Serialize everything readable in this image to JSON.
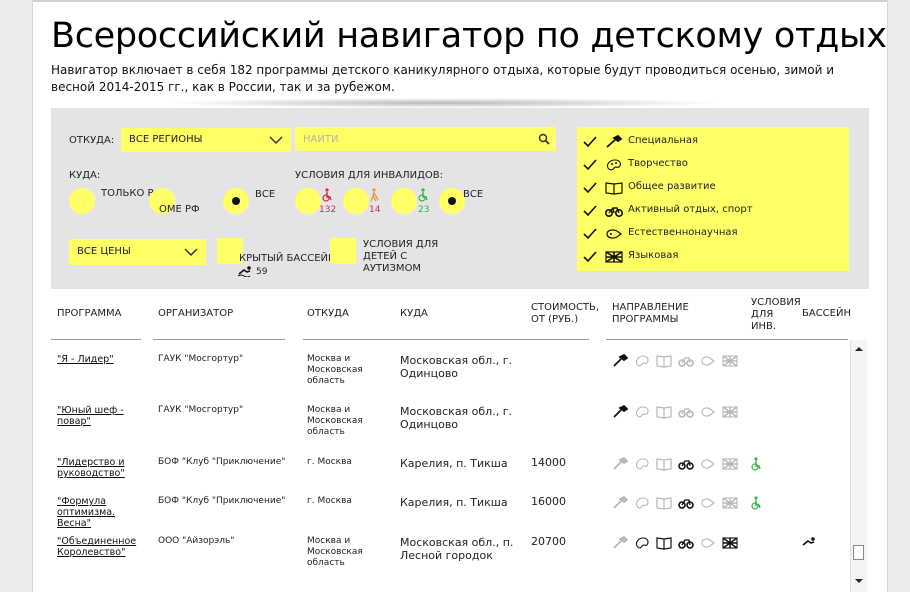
{
  "header": {
    "title": "Всероссийский навигатор по детскому отдыху",
    "intro": "Навигатор включает в себя 182 программы детского каникулярного отдыха, которые будут проводиться осенью, зимой и весной 2014-2015 гг., как в России, так и за рубежом."
  },
  "filters": {
    "from_label": "ОТКУДА:",
    "from_value": "ВСЕ РЕГИОНЫ",
    "search_placeholder": "НАЙТИ",
    "to_label": "КУДА:",
    "to_options": [
      "ТОЛЬКО РФ",
      "ОМЕ РФ",
      "ВСЕ"
    ],
    "to_selected": 2,
    "disabled_label": "УСЛОВИЯ ДЛЯ ИНВАЛИДОВ:",
    "disabled_counts": [
      "132",
      "14",
      "23"
    ],
    "disabled_all": "ВСЕ",
    "price_value": "ВСЕ ЦЕНЫ",
    "pool_label": "КРЫТЫЙ БАССЕЙН",
    "pool_count": "59",
    "autism_label": "УСЛОВИЯ ДЛЯ ДЕТЕЙ С АУТИЗМОМ",
    "directions": [
      {
        "label": "Специальная",
        "icon": "wrench-icon",
        "checked": true
      },
      {
        "label": "Творчество",
        "icon": "palette-icon",
        "checked": true
      },
      {
        "label": "Общее развитие",
        "icon": "book-icon",
        "checked": true
      },
      {
        "label": "Активный отдых, спорт",
        "icon": "bicycle-icon",
        "checked": true
      },
      {
        "label": "Естественнонаучная",
        "icon": "science-icon",
        "checked": true
      },
      {
        "label": "Языковая",
        "icon": "flag-icon",
        "checked": true
      }
    ]
  },
  "table": {
    "headers": {
      "program": "ПРОГРАММА",
      "organizer": "ОРГАНИЗАТОР",
      "from": "ОТКУДА",
      "to": "КУДА",
      "price": "СТОИМОСТЬ, ОТ (РУБ.)",
      "direction": "НАПРАВЛЕНИЕ ПРОГРАММЫ",
      "disabled": "УСЛОВИЯ ДЛЯ ИНВ.",
      "pool": "БАССЕЙН"
    },
    "rows": [
      {
        "program": "\"Я - Лидер\"",
        "organizer": "ГАУК \"Мосгортур\"",
        "from": "Москва и Московская область",
        "to": "Московская обл., г. Одинцово",
        "price": "",
        "active": [
          0
        ],
        "wheel": false,
        "pool": false
      },
      {
        "program": "\"Юный шеф - повар\"",
        "organizer": "ГАУК \"Мосгортур\"",
        "from": "Москва и Московская область",
        "to": "Московская обл., г. Одинцово",
        "price": "",
        "active": [
          0
        ],
        "wheel": false,
        "pool": false
      },
      {
        "program": "\"Лидерство и руководство\"",
        "organizer": "БОФ \"Клуб \"Приключение\"",
        "from": "г. Москва",
        "to": "Карелия, п. Тикша",
        "price": "14000",
        "active": [
          3
        ],
        "wheel": true,
        "pool": false
      },
      {
        "program": "\"Формула оптимизма. Весна\"",
        "organizer": "БОФ \"Клуб \"Приключение\"",
        "from": "г. Москва",
        "to": "Карелия, п. Тикша",
        "price": "16000",
        "active": [
          3
        ],
        "wheel": true,
        "pool": false
      },
      {
        "program": "\"Объединенное Королевство\"",
        "organizer": "ООО \"Айзорэль\"",
        "from": "Москва и Московская область",
        "to": "Московская обл., п. Лесной городок",
        "price": "20700",
        "active": [
          1,
          2,
          3,
          5
        ],
        "wheel": false,
        "pool": true
      }
    ]
  },
  "colors": {
    "highlight": "#ffff66",
    "panel": "#e4e4e6",
    "wheel_red": "#d4284a",
    "wheel_orange": "#e8952e",
    "wheel_green": "#35b24a",
    "inactive_icon": "#b8b8b8"
  }
}
